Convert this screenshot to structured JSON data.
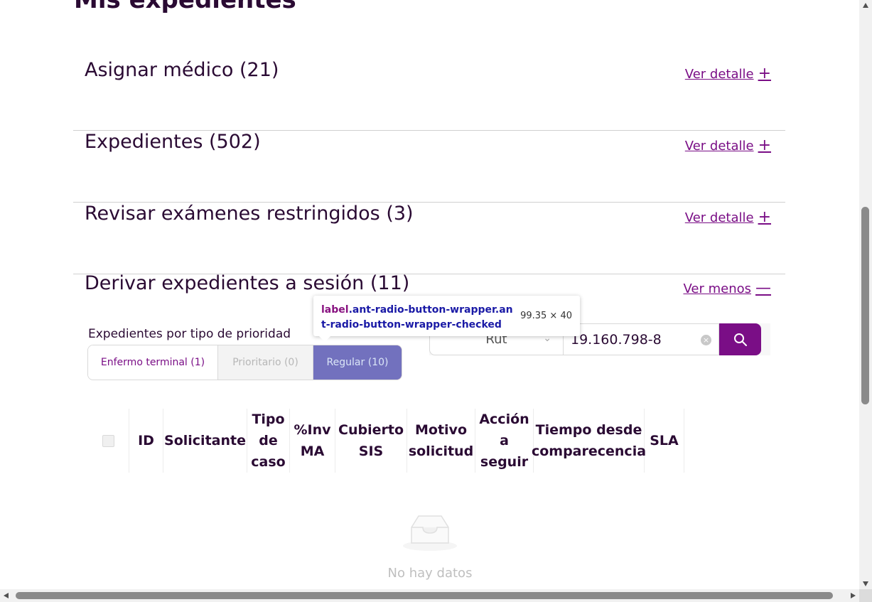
{
  "page": {
    "title": "Mis expedientes"
  },
  "sections": [
    {
      "title": "Asignar médico (21)",
      "link": "Ver detalle",
      "sign": "+"
    },
    {
      "title": "Expedientes (502)",
      "link": "Ver detalle",
      "sign": "+"
    },
    {
      "title": "Revisar exámenes restringidos (3)",
      "link": "Ver detalle",
      "sign": "+"
    },
    {
      "title": "Derivar expedientes a sesión (11)",
      "link": "Ver menos",
      "sign": "—"
    }
  ],
  "filter": {
    "label": "Expedientes por tipo de prioridad",
    "options": [
      "Enfermo terminal (1)",
      "Prioritario (0)",
      "Regular (10)"
    ],
    "selected": "Regular (10)"
  },
  "search": {
    "select_value": "Rut",
    "input_value": "19.160.798-8"
  },
  "tooltip": {
    "tag": "label",
    "classes": ".ant-radio-button-wrapper.ant-radio-button-wrapper-checked",
    "dims": "99.35 × 40"
  },
  "table": {
    "columns": [
      "ID",
      "Solicitante",
      "Tipo de caso",
      "%Inv MA",
      "Cubierto SIS",
      "Motivo solicitud",
      "Acción a seguir",
      "Tiempo desde comparecencia",
      "SLA"
    ],
    "empty_text": "No hay datos"
  },
  "colors": {
    "brand": "#7a0e86",
    "text": "#2a0a33"
  }
}
